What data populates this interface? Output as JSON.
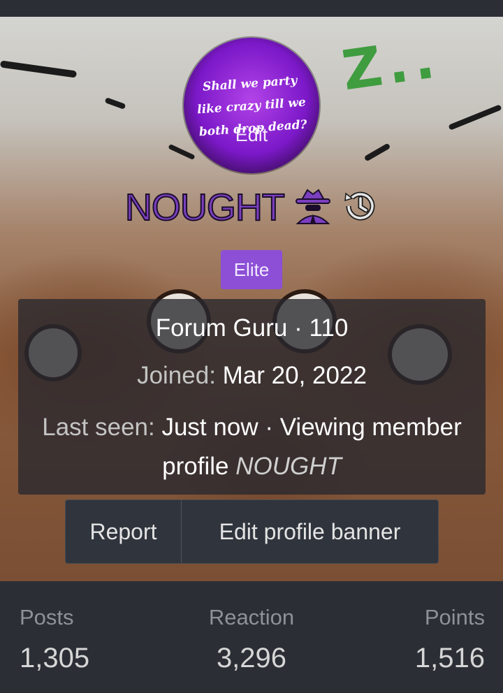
{
  "profile": {
    "avatar_text": [
      "Shall we party",
      "like crazy till we",
      "both drop dead?"
    ],
    "avatar_edit_label": "Edit",
    "username": "NOUGHT",
    "badge": "Elite",
    "icons": {
      "status": "spy-icon",
      "history": "history-icon"
    }
  },
  "info": {
    "title": "Forum Guru",
    "sep": "·",
    "level": "110",
    "joined_label": "Joined:",
    "joined_value": "Mar 20, 2022",
    "lastseen_label": "Last seen:",
    "lastseen_value": "Just now",
    "activity": "Viewing member profile",
    "activity_target": "NOUGHT"
  },
  "actions": {
    "report": "Report",
    "edit_banner": "Edit profile banner"
  },
  "stats": [
    {
      "label": "Posts",
      "value": "1,305"
    },
    {
      "label": "Reaction",
      "value": "3,296"
    },
    {
      "label": "Points",
      "value": "1,516"
    }
  ],
  "colors": {
    "accent": "#8c4fd6",
    "username": "#7b3fbf",
    "panel": "#2b2e35"
  }
}
